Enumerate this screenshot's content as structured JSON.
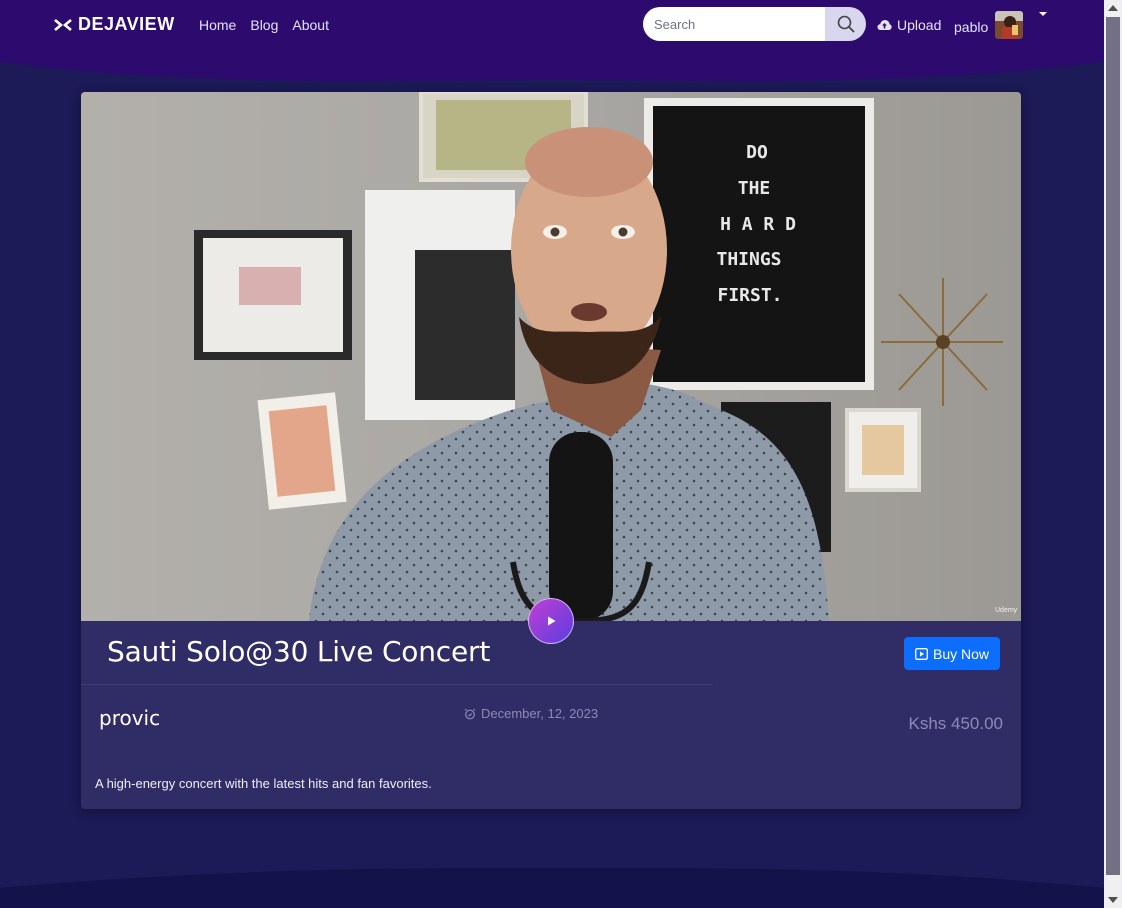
{
  "navbar": {
    "brand": "DEJAVIEW",
    "links": [
      "Home",
      "Blog",
      "About"
    ],
    "search_placeholder": "Search",
    "upload_label": "Upload",
    "username": "pablo"
  },
  "event": {
    "title": "Sauti Solo@30 Live Concert",
    "buy_label": "Buy Now",
    "organizer": "provic",
    "date": "December, 12, 2023",
    "price": "Kshs 450.00",
    "description": "A high-energy concert with the latest hits and fan favorites."
  },
  "video_overlay": {
    "board_lines": [
      "DO",
      "THE",
      "H A R D",
      "THINGS",
      "FIRST."
    ],
    "watermark": "Udemy"
  },
  "colors": {
    "nav_bg": "#2d0a6e",
    "page_bg": "#1c1a57",
    "card_bg": "#302c66",
    "primary_button": "#0d6efd"
  },
  "icons": {
    "brand": "brand-icon",
    "search": "search-icon",
    "upload": "cloud-upload-icon",
    "play": "play-icon",
    "buy": "play-box-icon",
    "date": "alarm-clock-icon"
  }
}
